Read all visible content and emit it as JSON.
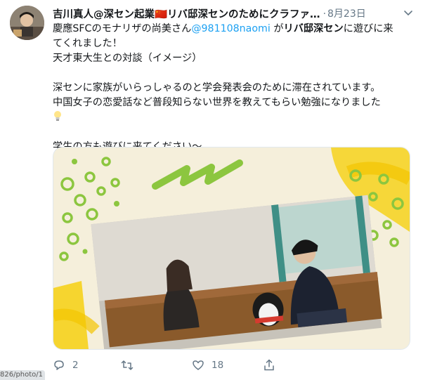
{
  "tweet": {
    "author_name": "吉川真人@深セン起業🇨🇳リバ邸深センのためにクラファ…",
    "separator": "·",
    "date": "8月23日",
    "lines": {
      "l1_pre": "慶應SFCのモナリザの尚美さん",
      "l1_mention": "@981108naomi",
      "l1_mid": " が",
      "l1_bold": "リバ邸深セン",
      "l1_post": "に遊びに来",
      "l2": "てくれました！",
      "l3": "天才東大生との対談（イメージ）",
      "l4": "深センに家族がいらっしゃるのと学会発表会のために滞在されています。",
      "l5": "中国女子の恋愛話など普段知らない世界を教えてもらい勉強になりました",
      "l7": "学生の方も遊びに来てください〜"
    },
    "actions": {
      "reply_count": "2",
      "retweet_count": "",
      "like_count": "18"
    }
  },
  "status_url": "826/photo/1",
  "icons": [
    "chevron-down-icon",
    "lightbulb-icon",
    "reply-icon",
    "retweet-icon",
    "like-icon",
    "share-icon"
  ],
  "colors": {
    "accent": "#1da1f2",
    "muted": "#657786",
    "text": "#14171a",
    "brush_green": "#8cc63f",
    "brush_yellow": "#f6d21c"
  }
}
